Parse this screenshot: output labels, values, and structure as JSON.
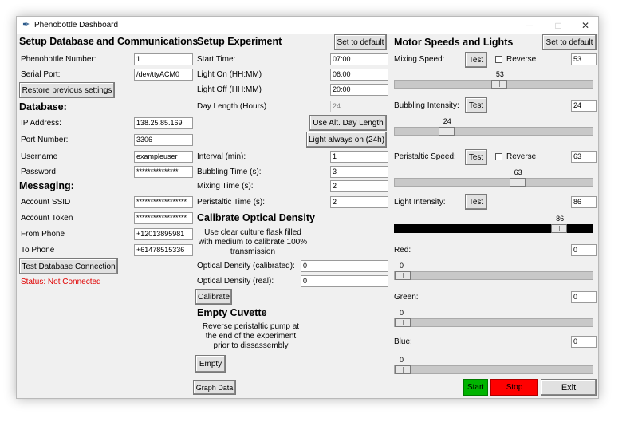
{
  "window": {
    "title": "Phenobottle Dashboard",
    "minimize": "─",
    "maximize": "□",
    "close": "✕",
    "icon": "feather-icon"
  },
  "col1": {
    "heading": "Setup Database and Communications",
    "phenobottle_number_label": "Phenobottle Number:",
    "phenobottle_number": "1",
    "serial_port_label": "Serial Port:",
    "serial_port": "/dev/ttyACM0",
    "restore_button": "Restore previous settings",
    "database_heading": "Database:",
    "ip_label": "IP Address:",
    "ip": "138.25.85.169",
    "port_label": "Port Number:",
    "port": "3306",
    "username_label": "Username",
    "username": "exampleuser",
    "password_label": "Password",
    "password": "***************",
    "messaging_heading": "Messaging:",
    "ssid_label": "Account SSID",
    "ssid": "******************",
    "token_label": "Account Token",
    "token": "******************",
    "from_label": "From Phone",
    "from_phone": "+12013895981",
    "to_label": "To Phone",
    "to_phone": "+61478515336",
    "test_db_button": "Test Database Connection",
    "status": "Status: Not Connected"
  },
  "col2": {
    "heading": "Setup Experiment",
    "default_button": "Set to default",
    "start_label": "Start Time:",
    "start": "07:00",
    "light_on_label": "Light On (HH:MM)",
    "light_on": "06:00",
    "light_off_label": "Light Off (HH:MM)",
    "light_off": "20:00",
    "day_length_label": "Day Length (Hours)",
    "day_length": "24",
    "alt_day_button": "Use Alt. Day Length",
    "light_always_button": "Light always on (24h)",
    "interval_label": "Interval (min):",
    "interval": "1",
    "bubbling_label": "Bubbling Time (s):",
    "bubbling": "3",
    "mixing_label": "Mixing Time (s):",
    "mixing": "2",
    "peristaltic_label": "Peristaltic Time (s):",
    "peristaltic": "2",
    "calibrate_heading": "Calibrate Optical Density",
    "calibrate_desc": "Use clear culture flask filled with medium to calibrate 100% transmission",
    "od_cal_label": "Optical Density (calibrated):",
    "od_cal": "0",
    "od_real_label": "Optical Density (real):",
    "od_real": "0",
    "calibrate_button": "Calibrate",
    "cuvette_heading": "Empty Cuvette",
    "cuvette_desc": "Reverse peristaltic pump at the end of the experiment prior to dissassembly",
    "empty_button": "Empty",
    "graph_button": "Graph Data"
  },
  "col3": {
    "heading": "Motor Speeds and Lights",
    "default_button": "Set to default",
    "test_label": "Test",
    "reverse_label": "Reverse",
    "mixing_label": "Mixing Speed:",
    "mixing_value": "53",
    "mixing_level": 53,
    "bubbling_label": "Bubbling Intensity:",
    "bubbling_value": "24",
    "bubbling_level": 24,
    "peristaltic_label": "Peristaltic Speed:",
    "peristaltic_value": "63",
    "peristaltic_level": 63,
    "light_label": "Light Intensity:",
    "light_value": "86",
    "light_level": 86,
    "red_label": "Red:",
    "red_value": "0",
    "red_level": 0,
    "green_label": "Green:",
    "green_value": "0",
    "green_level": 0,
    "blue_label": "Blue:",
    "blue_value": "0",
    "blue_level": 0,
    "start_button": "Start",
    "stop_button": "Stop",
    "exit_button": "Exit"
  },
  "colors": {
    "start": "#00b400",
    "stop": "#ff0000",
    "status": "#e00000",
    "light_trough": "#000000"
  }
}
